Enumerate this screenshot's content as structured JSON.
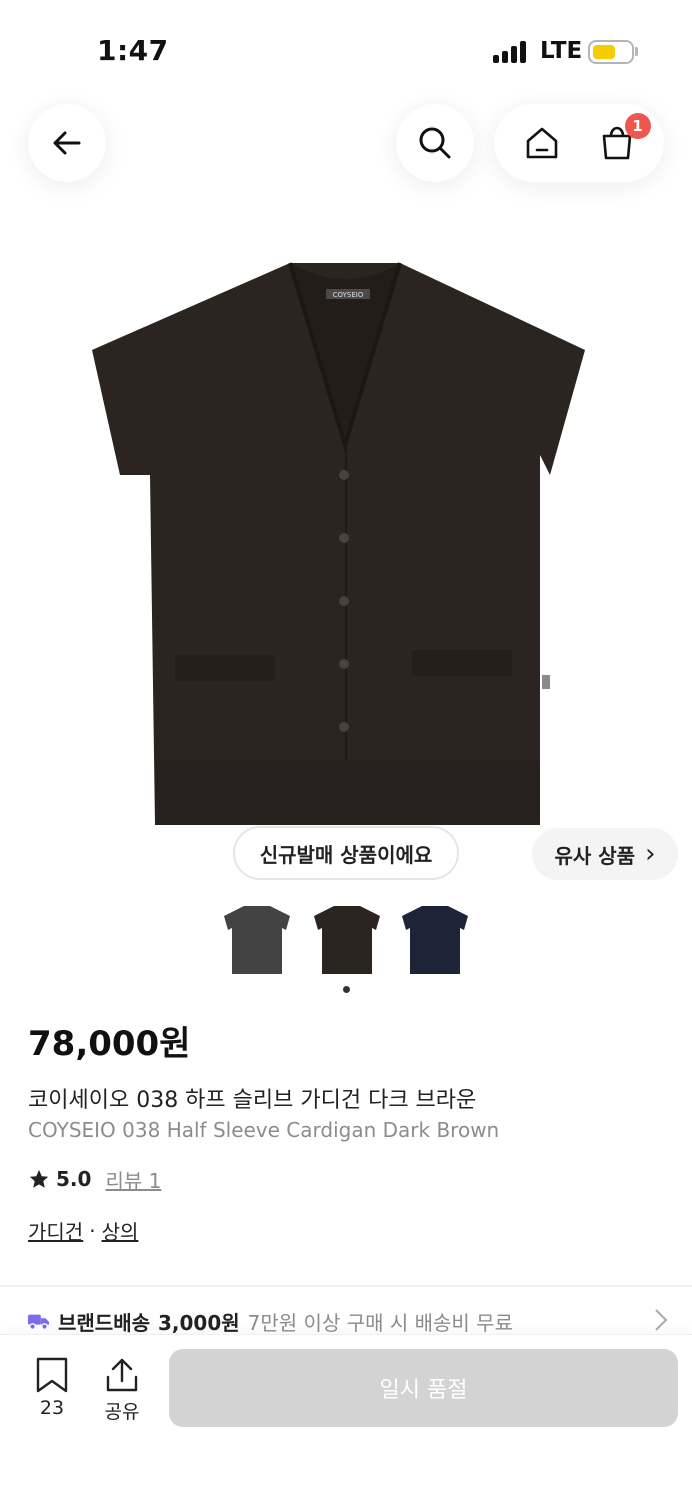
{
  "status_bar": {
    "time": "1:47",
    "network": "LTE",
    "battery_color": "#f5cc00"
  },
  "header": {
    "cart_count": "1",
    "icons": [
      "arrow-left-icon",
      "search-icon",
      "home-icon",
      "shopping-bag-icon"
    ]
  },
  "product": {
    "badge_new": "신규발매 상품이에요",
    "similar_label": "유사 상품",
    "similar_chevron": "›",
    "color_options": [
      {
        "name": "charcoal",
        "color": "#434344"
      },
      {
        "name": "dark-brown",
        "color": "#2b2420"
      },
      {
        "name": "navy",
        "color": "#1d2438"
      }
    ],
    "price": "78,000원",
    "name_ko": "코이세이오 038 하프 슬리브 가디건 다크 브라운",
    "name_en": "COYSEIO 038 Half Sleeve Cardigan Dark Brown",
    "rating": "5.0",
    "review_label": "리뷰 1",
    "category_1": "가디건",
    "category_sep": "·",
    "category_2": "상의",
    "garment_color": "#2b2420"
  },
  "shipping": {
    "brand_label": "브랜드배송",
    "price": "3,000원",
    "note": "7만원 이상 구매 시 배송비 무료",
    "icon_color": "#7d6bf0"
  },
  "bottom_bar": {
    "bookmark_count": "23",
    "share_label": "공유",
    "buy_label": "일시 품절"
  }
}
